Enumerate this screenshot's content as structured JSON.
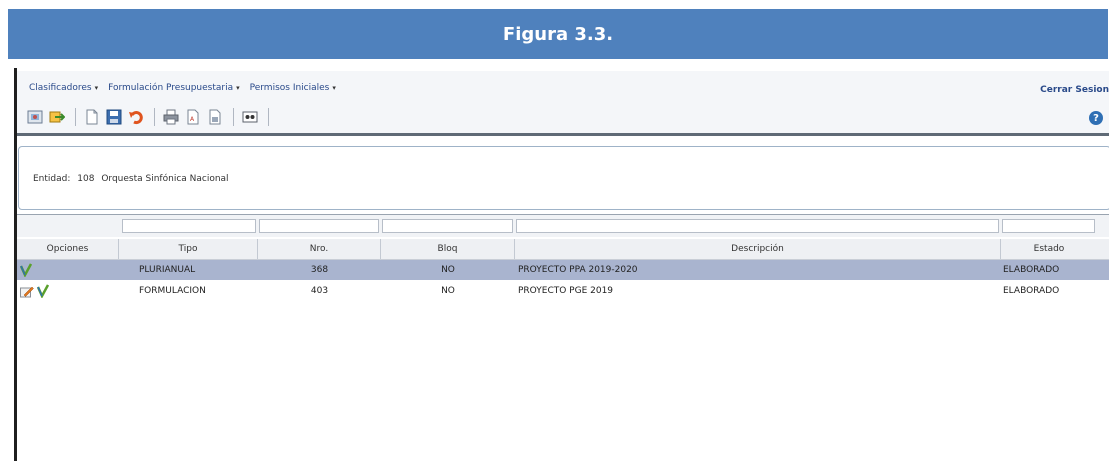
{
  "figure_title": "Figura 3.3.",
  "menu": {
    "items": [
      {
        "label": "Clasificadores"
      },
      {
        "label": "Formulación Presupuestaria"
      },
      {
        "label": "Permisos Iniciales"
      }
    ],
    "logout_label": "Cerrar Sesion"
  },
  "toolbar": {
    "buttons": [
      "home-icon",
      "exit-icon",
      "new-document-icon",
      "save-icon",
      "undo-icon",
      "print-icon",
      "pdf-report-icon",
      "export-report-icon",
      "view-icon"
    ],
    "help_label": "?"
  },
  "entity": {
    "label": "Entidad:",
    "code": "108",
    "name": "Orquesta Sinfónica Nacional"
  },
  "grid": {
    "columns": [
      "Opciones",
      "Tipo",
      "Nro.",
      "Bloq",
      "Descripción",
      "Estado"
    ],
    "rows": [
      {
        "tipo": "PLURIANUAL",
        "nro": "368",
        "bloq": "NO",
        "descripcion": "PROYECTO PPA 2019-2020",
        "estado": "ELABORADO",
        "options": [
          "approve-icon"
        ],
        "selected": true
      },
      {
        "tipo": "FORMULACION",
        "nro": "403",
        "bloq": "NO",
        "descripcion": "PROYECTO PGE 2019",
        "estado": "ELABORADO",
        "options": [
          "edit-icon",
          "approve-icon"
        ],
        "selected": false
      }
    ]
  },
  "colors": {
    "banner": "#4f81bd",
    "selected_row": "#a9b4cf",
    "menu_text": "#2a4a8a"
  }
}
